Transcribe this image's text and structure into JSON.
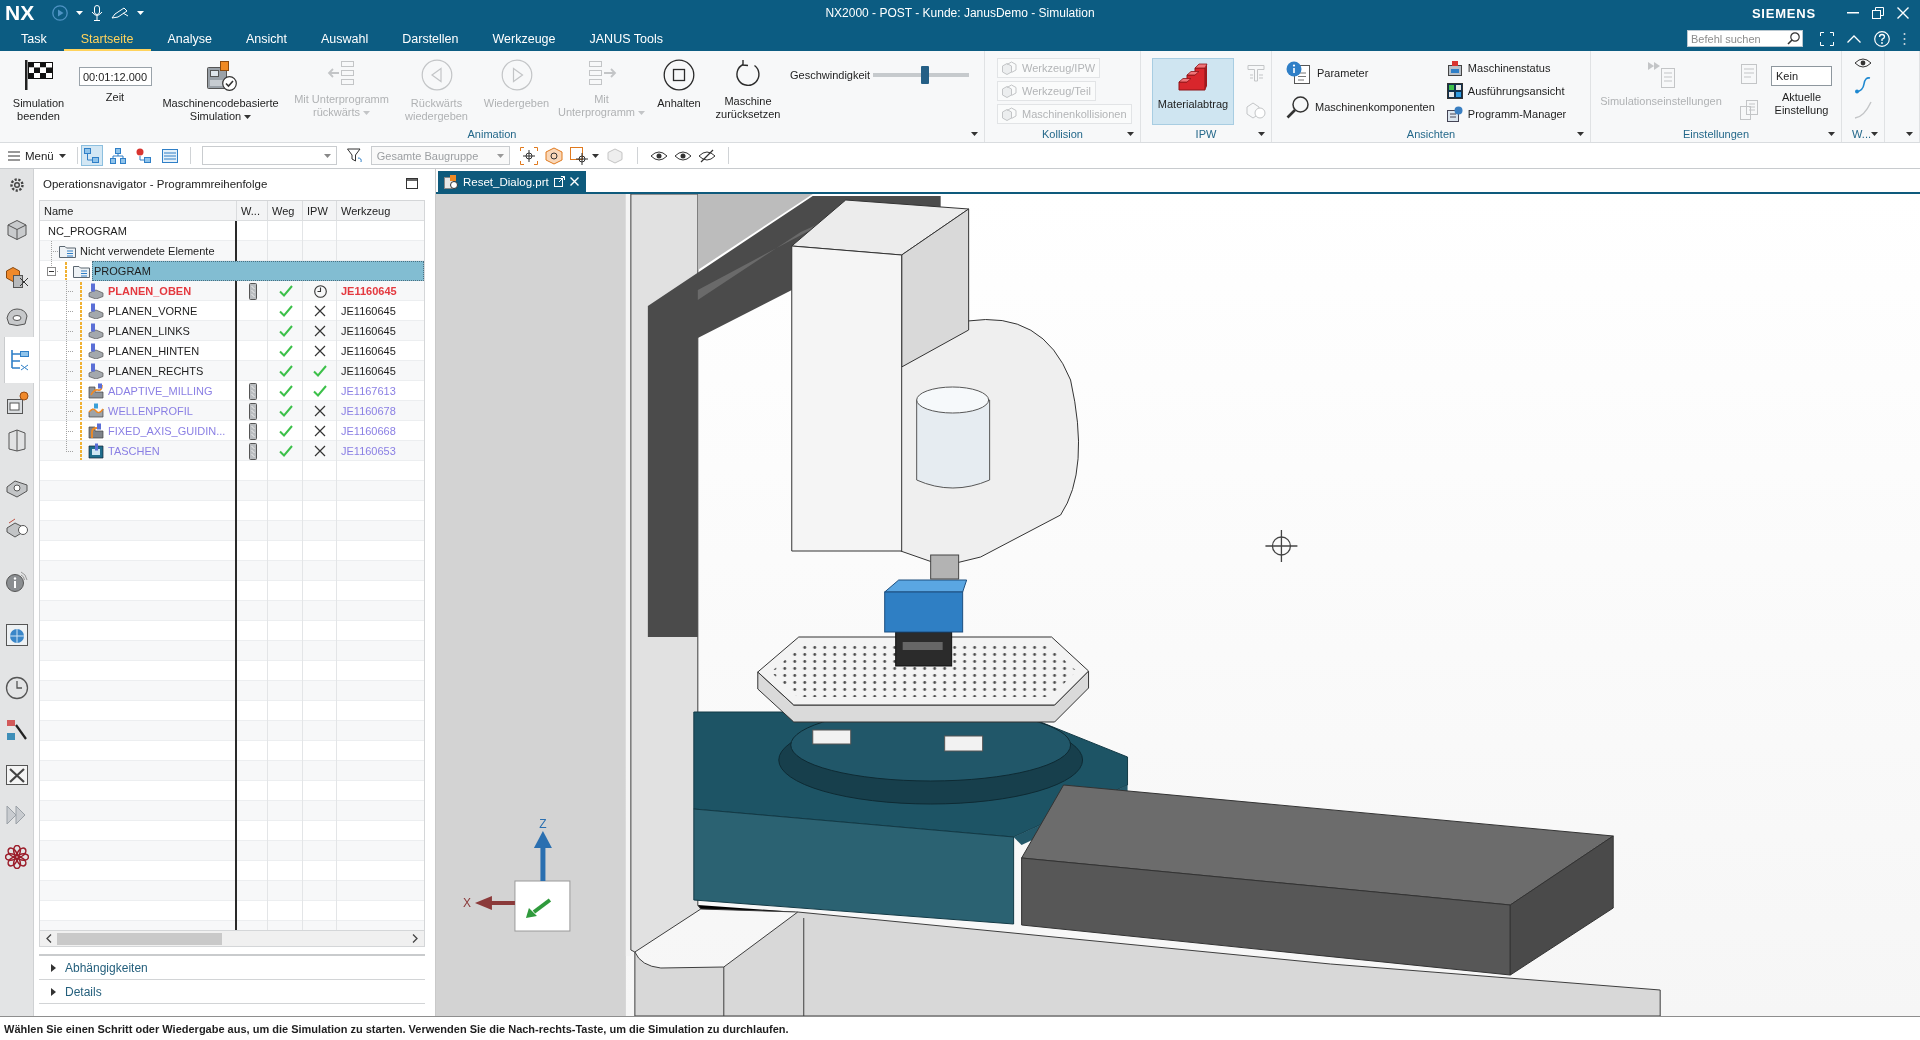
{
  "title_bar": {
    "logo": "NX",
    "title": "NX2000 - POST - Kunde: JanusDemo - Simulation",
    "brand": "SIEMENS"
  },
  "ribbon_tabs": [
    {
      "label": "Task",
      "selected": false
    },
    {
      "label": "Startseite",
      "selected": true
    },
    {
      "label": "Analyse",
      "selected": false
    },
    {
      "label": "Ansicht",
      "selected": false
    },
    {
      "label": "Auswahl",
      "selected": false
    },
    {
      "label": "Darstellen",
      "selected": false
    },
    {
      "label": "Werkzeuge",
      "selected": false
    },
    {
      "label": "JANUS Tools",
      "selected": false
    }
  ],
  "command_search": {
    "placeholder": "Befehl suchen"
  },
  "ribbon_groups": [
    {
      "label": "Animation",
      "items": [
        {
          "kind": "large",
          "label": "Simulation\nbeenden",
          "disabled": false
        },
        {
          "kind": "timer",
          "value": "00:01:12.000",
          "label": "Zeit"
        },
        {
          "kind": "large",
          "label": "Maschinencodebasierte\nSimulation",
          "dropdown": true,
          "disabled": false
        },
        {
          "kind": "large",
          "label": "Mit Unterprogramm\nrückwärts",
          "dropdown": true,
          "disabled": true
        },
        {
          "kind": "large",
          "label": "Rückwärts\nwiedergeben",
          "disabled": true
        },
        {
          "kind": "large",
          "label": "Wiedergeben",
          "disabled": true
        },
        {
          "kind": "large",
          "label": "Mit\nUnterprogramm",
          "dropdown": true,
          "disabled": true
        },
        {
          "kind": "large",
          "label": "Anhalten",
          "disabled": false
        },
        {
          "kind": "large",
          "label": "Maschine\nzurücksetzen",
          "disabled": false
        },
        {
          "kind": "slider",
          "label": "Geschwindigkeit",
          "level": 0.54
        }
      ]
    },
    {
      "label": "Kollision",
      "items": [
        {
          "kind": "stack",
          "items": [
            {
              "label": "Werkzeug/IPW",
              "disabled": true
            },
            {
              "label": "Werkzeug/Teil",
              "disabled": true
            },
            {
              "label": "Maschinenkollisionen",
              "disabled": true
            }
          ]
        }
      ]
    },
    {
      "label": "IPW",
      "items": [
        {
          "kind": "large",
          "label": "Materialabtrag",
          "disabled": false,
          "selected": true
        },
        {
          "kind": "icons",
          "items": [
            {
              "disabled": true
            },
            {
              "disabled": true
            }
          ]
        }
      ]
    },
    {
      "label": "Ansichten",
      "items": [
        {
          "kind": "stack",
          "items": [
            {
              "label": "Parameter",
              "disabled": false
            },
            {
              "label": "Maschinenkomponenten",
              "disabled": false
            }
          ]
        },
        {
          "kind": "stack",
          "items": [
            {
              "label": "Maschinenstatus",
              "disabled": false
            },
            {
              "label": "Ausführungsansicht",
              "disabled": false
            },
            {
              "label": "Programm-Manager",
              "disabled": false
            }
          ]
        }
      ]
    },
    {
      "label": "Einstellungen",
      "items": [
        {
          "kind": "large",
          "label": "Simulationseinstellungen",
          "disabled": true
        },
        {
          "kind": "icons",
          "items": [
            {
              "disabled": true
            },
            {
              "disabled": true
            }
          ]
        },
        {
          "kind": "setting",
          "value": "Kein",
          "label": "Aktuelle\nEinstellung"
        }
      ]
    },
    {
      "label": "W...",
      "items": [
        {
          "kind": "icons",
          "items": [
            {
              "disabled": false
            },
            {
              "disabled": false
            },
            {
              "disabled": true
            }
          ]
        }
      ]
    }
  ],
  "toolbar": {
    "menu": "Menü",
    "views": [
      {
        "selected": true
      },
      {
        "selected": false
      },
      {
        "selected": false
      },
      {
        "selected": false
      }
    ],
    "scope": {
      "value": "Gesamte Baugruppe",
      "disabled": true
    }
  },
  "resource_bar": [
    {
      "selected": false
    },
    {
      "selected": false
    },
    {
      "selected": false
    },
    {
      "selected": false
    },
    {
      "selected": true
    },
    {
      "selected": false
    },
    {
      "selected": false
    },
    {
      "selected": false
    },
    {
      "selected": false
    },
    {
      "selected": false
    },
    {
      "selected": false
    },
    {
      "selected": false
    },
    {
      "selected": false
    },
    {
      "selected": false
    },
    {
      "selected": false
    },
    {
      "selected": false
    }
  ],
  "navigator": {
    "title": "Operationsnavigator - Programmreihenfolge",
    "columns": [
      "Name",
      "W...",
      "Weg",
      "IPW",
      "Werkzeug"
    ],
    "tree": [
      {
        "name": "NC_PROGRAM",
        "selected": false,
        "children": [
          {
            "name": "Nicht verwendete Elemente",
            "kind": "group",
            "selected": false
          },
          {
            "name": "PROGRAM",
            "kind": "program",
            "selected": true,
            "expanded": true,
            "children": [
              {
                "name": "PLANEN_OBEN",
                "kind": "face",
                "selected": false,
                "current": true,
                "color": "#e4393f",
                "holder": true,
                "weg_done": true,
                "ipw_done": false,
                "ipw_pending": true,
                "tool": "JE1160645"
              },
              {
                "name": "PLANEN_VORNE",
                "kind": "face",
                "selected": false,
                "current": false,
                "color": "#1e1e1e",
                "weg_done": true,
                "ipw_done": false,
                "ipw_pending": false,
                "tool": "JE1160645"
              },
              {
                "name": "PLANEN_LINKS",
                "kind": "face",
                "selected": false,
                "current": false,
                "color": "#1e1e1e",
                "weg_done": true,
                "ipw_done": false,
                "ipw_pending": false,
                "tool": "JE1160645"
              },
              {
                "name": "PLANEN_HINTEN",
                "kind": "face",
                "selected": false,
                "current": false,
                "color": "#1e1e1e",
                "weg_done": true,
                "ipw_done": false,
                "ipw_pending": false,
                "tool": "JE1160645"
              },
              {
                "name": "PLANEN_RECHTS",
                "kind": "face",
                "selected": false,
                "current": false,
                "color": "#1e1e1e",
                "weg_done": true,
                "ipw_done": true,
                "ipw_pending": false,
                "tool": "JE1160645"
              },
              {
                "name": "ADAPTIVE_MILLING",
                "kind": "adaptive",
                "selected": false,
                "current": false,
                "color": "#8a7fe4",
                "holder": true,
                "weg_done": true,
                "ipw_done": true,
                "ipw_pending": false,
                "tool": "JE1167613"
              },
              {
                "name": "WELLENPROFIL",
                "kind": "profile",
                "selected": false,
                "current": false,
                "color": "#8a7fe4",
                "holder": true,
                "weg_done": true,
                "ipw_done": false,
                "ipw_pending": false,
                "tool": "JE1160678"
              },
              {
                "name": "FIXED_AXIS_GUIDIN...",
                "kind": "fixed_axis",
                "selected": false,
                "current": false,
                "color": "#8a7fe4",
                "holder": true,
                "weg_done": true,
                "ipw_done": false,
                "ipw_pending": false,
                "tool": "JE1160668"
              },
              {
                "name": "TASCHEN",
                "kind": "pocket",
                "selected": false,
                "current": false,
                "color": "#8a7fe4",
                "holder": true,
                "weg_done": true,
                "ipw_done": false,
                "ipw_pending": false,
                "tool": "JE1160653"
              }
            ]
          }
        ]
      }
    ],
    "panels": [
      {
        "label": "Abhängigkeiten",
        "expanded": false
      },
      {
        "label": "Details",
        "expanded": false
      }
    ]
  },
  "viewport": {
    "tabs": [
      {
        "label": "Reset_Dialog.prt",
        "selected": true
      }
    ],
    "axes": {
      "z": "Z",
      "x": "X"
    }
  },
  "status_bar": {
    "message": "Wählen Sie einen Schritt oder Wiedergabe aus, um die Simulation zu starten. Verwenden Sie die Nach-rechts-Taste, um die Simulation zu durchlaufen."
  }
}
